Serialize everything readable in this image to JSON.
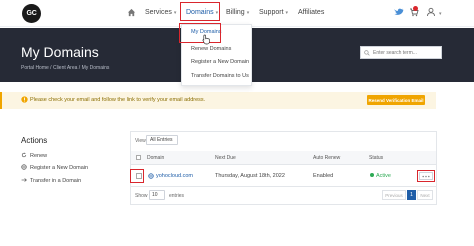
{
  "brand": {
    "logo_text": "GC"
  },
  "nav": {
    "services": "Services",
    "domains": "Domains",
    "billing": "Billing",
    "support": "Support",
    "affiliates": "Affiliates",
    "caret": "▾"
  },
  "domains_menu": {
    "items": [
      {
        "label": "My Domains"
      },
      {
        "label": "Renew Domains"
      },
      {
        "label": "Register a New Domain"
      },
      {
        "label": "Transfer Domains to Us"
      }
    ]
  },
  "header": {
    "title": "My Domains",
    "breadcrumb": "Portal Home / Client Area / My Domains",
    "search_placeholder": "Enter search term..."
  },
  "alert": {
    "text": "Please check your email and follow the link to verify your email address.",
    "button": "Resend Verification Email"
  },
  "actions": {
    "title": "Actions",
    "items": [
      {
        "label": "Renew"
      },
      {
        "label": "Register a New Domain"
      },
      {
        "label": "Transfer in a Domain"
      }
    ]
  },
  "table": {
    "view_label": "View",
    "view_value": "All Entries",
    "columns": [
      "Domain",
      "Next Due",
      "Auto Renew",
      "Status"
    ],
    "rows": [
      {
        "domain": "yohocloud.com",
        "next_due": "Thursday, August 18th, 2022",
        "auto_renew": "Enabled",
        "status": "Active"
      }
    ],
    "show_label": "Show",
    "show_value": "10",
    "entries_label": "entries",
    "pagination": {
      "previous": "Previous",
      "current": "1",
      "next": "Next"
    }
  },
  "colors": {
    "accent": "#1f5ea8",
    "hero_bg": "#262a36",
    "warning": "#f0a500",
    "highlight": "#d9262d",
    "active": "#2eaa55"
  }
}
